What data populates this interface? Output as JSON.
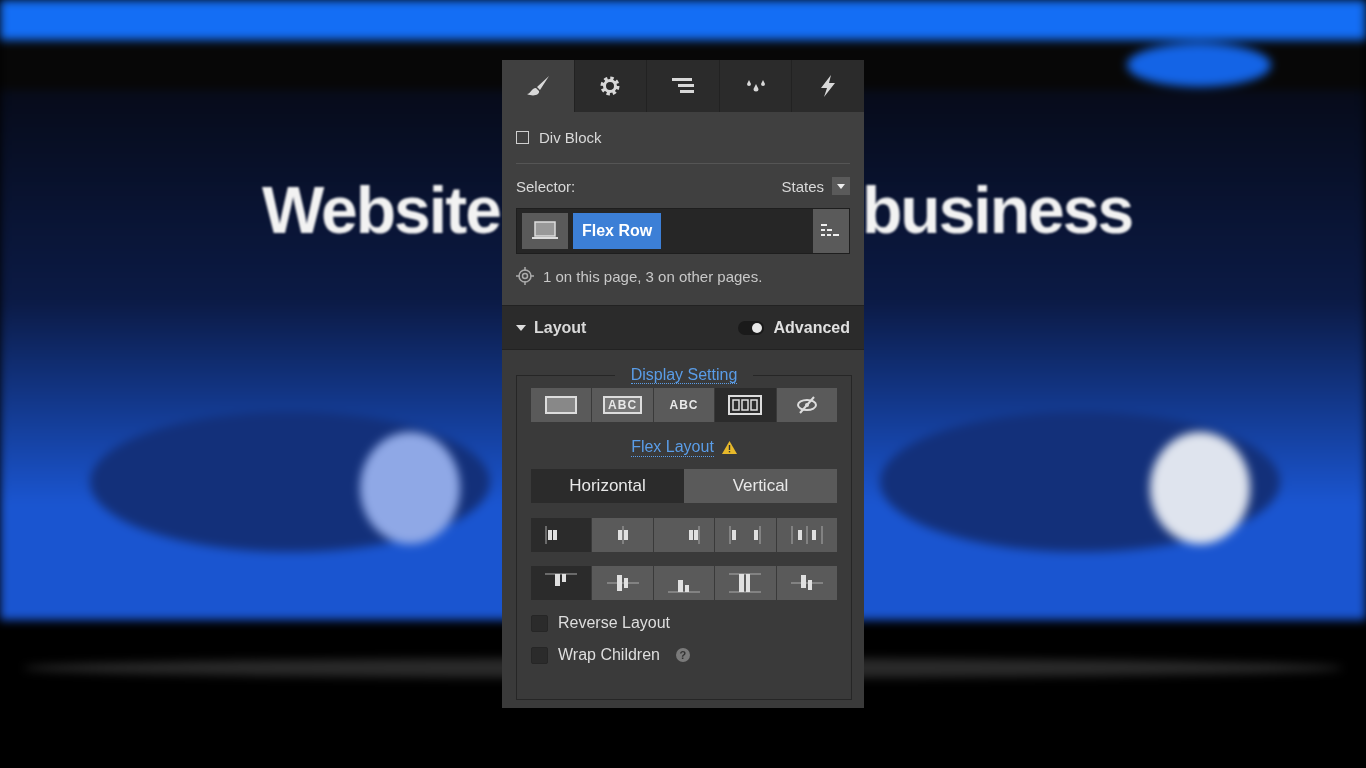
{
  "backdrop": {
    "kind": "picture",
    "headline_left": "Website",
    "headline_right": "business"
  },
  "panel": {
    "tabs": [
      {
        "kind": "brush",
        "selected": true
      },
      {
        "kind": "gear",
        "selected": false
      },
      {
        "kind": "lines",
        "selected": false
      },
      {
        "kind": "drops",
        "selected": false
      },
      {
        "kind": "bolt",
        "selected": false
      }
    ],
    "element": {
      "label": "Div Block"
    },
    "selector": {
      "label": "Selector:",
      "states_label": "States",
      "class_chip": "Flex Row",
      "usage": "1 on this page, 3 on other pages."
    },
    "layout": {
      "title": "Layout",
      "expanded": true,
      "advanced": {
        "label": "Advanced",
        "on": true
      },
      "display": {
        "title": "Display Setting",
        "options": [
          {
            "kind": "block",
            "selected": false
          },
          {
            "kind": "inline-block",
            "label": "ABC",
            "selected": false
          },
          {
            "kind": "inline",
            "label": "ABC",
            "selected": false
          },
          {
            "kind": "flex",
            "selected": true
          },
          {
            "kind": "none",
            "selected": false
          }
        ]
      },
      "flex": {
        "title": "Flex Layout",
        "warning": true,
        "directions": [
          {
            "label": "Horizontal",
            "selected": true
          },
          {
            "label": "Vertical",
            "selected": false
          }
        ],
        "justify": [
          {
            "kind": "start",
            "selected": true
          },
          {
            "kind": "center",
            "selected": false
          },
          {
            "kind": "end",
            "selected": false
          },
          {
            "kind": "between",
            "selected": false
          },
          {
            "kind": "around",
            "selected": false
          }
        ],
        "align": [
          {
            "kind": "start",
            "selected": true
          },
          {
            "kind": "center",
            "selected": false
          },
          {
            "kind": "end",
            "selected": false
          },
          {
            "kind": "stretch",
            "selected": false
          },
          {
            "kind": "baseline",
            "selected": false
          }
        ],
        "options": [
          {
            "label": "Reverse Layout",
            "checked": false
          },
          {
            "label": "Wrap Children",
            "checked": false,
            "help": "?"
          }
        ]
      }
    }
  }
}
